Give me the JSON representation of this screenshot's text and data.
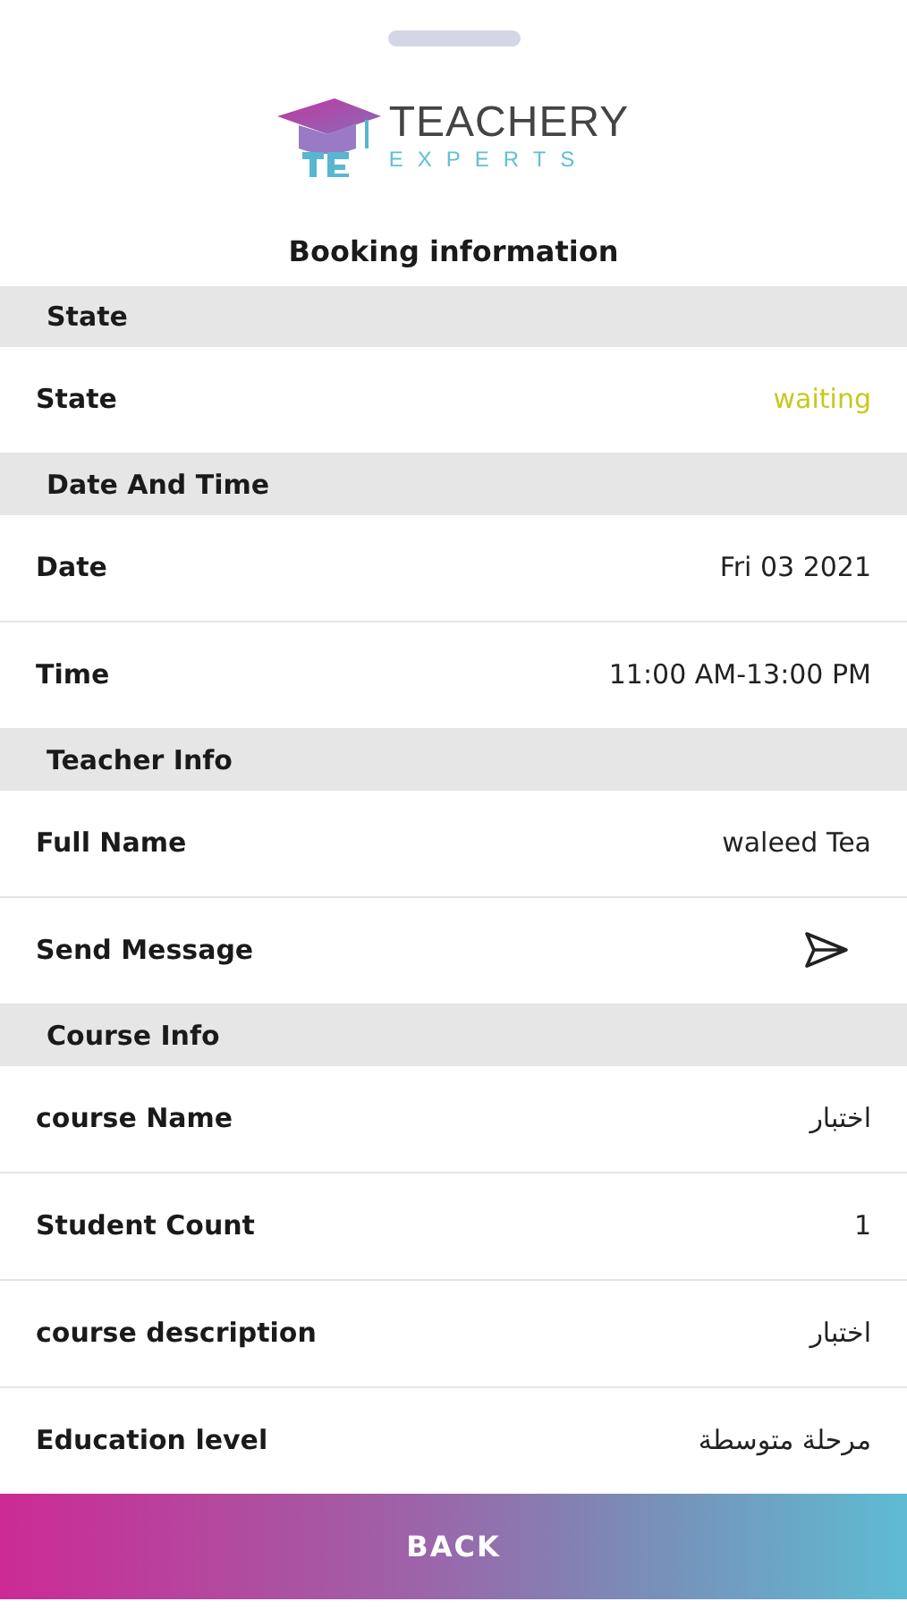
{
  "logo": {
    "name": "TEACHERY",
    "tagline": "EXPERTS"
  },
  "title": "Booking information",
  "sections": [
    {
      "heading": "State",
      "rows": [
        {
          "kind": "text",
          "label": "State",
          "value": "waiting",
          "color": "#c8c81e"
        }
      ]
    },
    {
      "heading": "Date And Time",
      "rows": [
        {
          "kind": "text",
          "label": "Date",
          "value": "Fri 03 2021"
        },
        {
          "kind": "text",
          "label": "Time",
          "value": "11:00 AM-13:00 PM"
        }
      ]
    },
    {
      "heading": "Teacher Info",
      "rows": [
        {
          "kind": "text",
          "label": "Full Name",
          "value": "waleed Tea"
        },
        {
          "kind": "action",
          "label": "Send Message"
        }
      ]
    },
    {
      "heading": "Course Info",
      "rows": [
        {
          "kind": "text",
          "label": "course Name",
          "value": "اختبار"
        },
        {
          "kind": "text",
          "label": "Student Count",
          "value": "1"
        },
        {
          "kind": "text",
          "label": "course description",
          "value": "اختبار"
        },
        {
          "kind": "text",
          "label": "Education level",
          "value": "مرحلة متوسطة"
        }
      ]
    }
  ],
  "button": "BACK"
}
